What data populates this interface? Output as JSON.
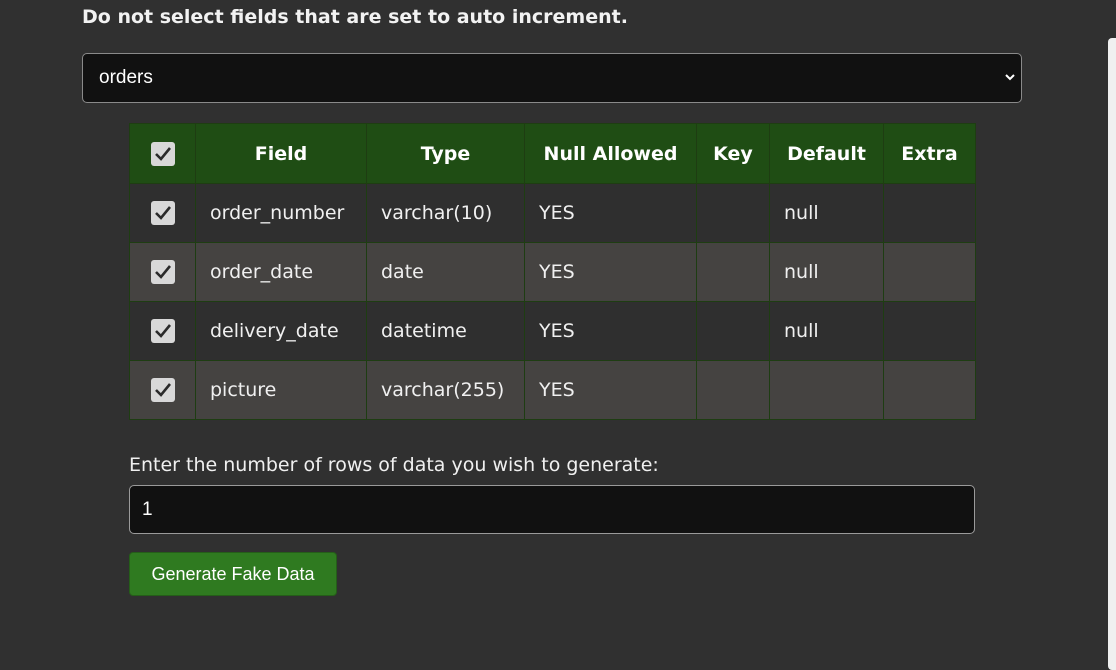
{
  "warning": "Do not select fields that are set to auto increment.",
  "table_select": {
    "selected": "orders"
  },
  "columns": {
    "field": "Field",
    "type": "Type",
    "null_allowed": "Null Allowed",
    "key": "Key",
    "default": "Default",
    "extra": "Extra"
  },
  "header_checked": true,
  "rows": [
    {
      "checked": true,
      "field": "order_number",
      "type": "varchar(10)",
      "null_allowed": "YES",
      "key": "",
      "default": "null",
      "extra": ""
    },
    {
      "checked": true,
      "field": "order_date",
      "type": "date",
      "null_allowed": "YES",
      "key": "",
      "default": "null",
      "extra": ""
    },
    {
      "checked": true,
      "field": "delivery_date",
      "type": "datetime",
      "null_allowed": "YES",
      "key": "",
      "default": "null",
      "extra": ""
    },
    {
      "checked": true,
      "field": "picture",
      "type": "varchar(255)",
      "null_allowed": "YES",
      "key": "",
      "default": "",
      "extra": ""
    }
  ],
  "rows_prompt": {
    "label": "Enter the number of rows of data you wish to generate:",
    "value": "1"
  },
  "generate_button": "Generate Fake Data",
  "colors": {
    "background": "#303030",
    "header_green": "#1f4d14",
    "button_green": "#2f7a20"
  }
}
